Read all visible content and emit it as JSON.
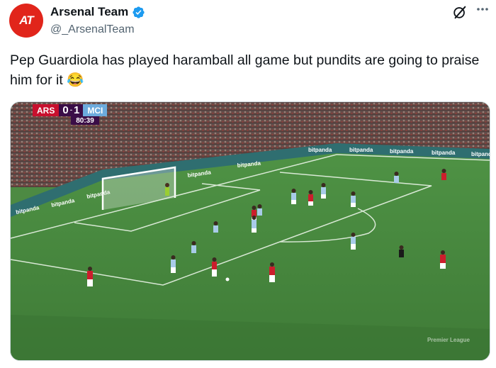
{
  "author": {
    "display_name": "Arsenal Team",
    "handle": "@_ArsenalTeam",
    "avatar_text": "AT",
    "avatar_color": "#e1251b",
    "verified": true
  },
  "icons": {
    "verified": "verified-badge-icon",
    "grok": "grok-icon",
    "more": "more-options-icon"
  },
  "tweet": {
    "text": "Pep Guardiola has played haramball all game but pundits are going to praise him for it 😂"
  },
  "media": {
    "scoreboard": {
      "home": "ARS",
      "home_score": "0",
      "away_score": "1",
      "away": "MCI",
      "time": "80:39",
      "home_color": "#c8102e",
      "away_color": "#6cabdd"
    },
    "watermark": "Premier League",
    "ad_text": "bitpanda",
    "pitch_color": "#4d8a43"
  }
}
